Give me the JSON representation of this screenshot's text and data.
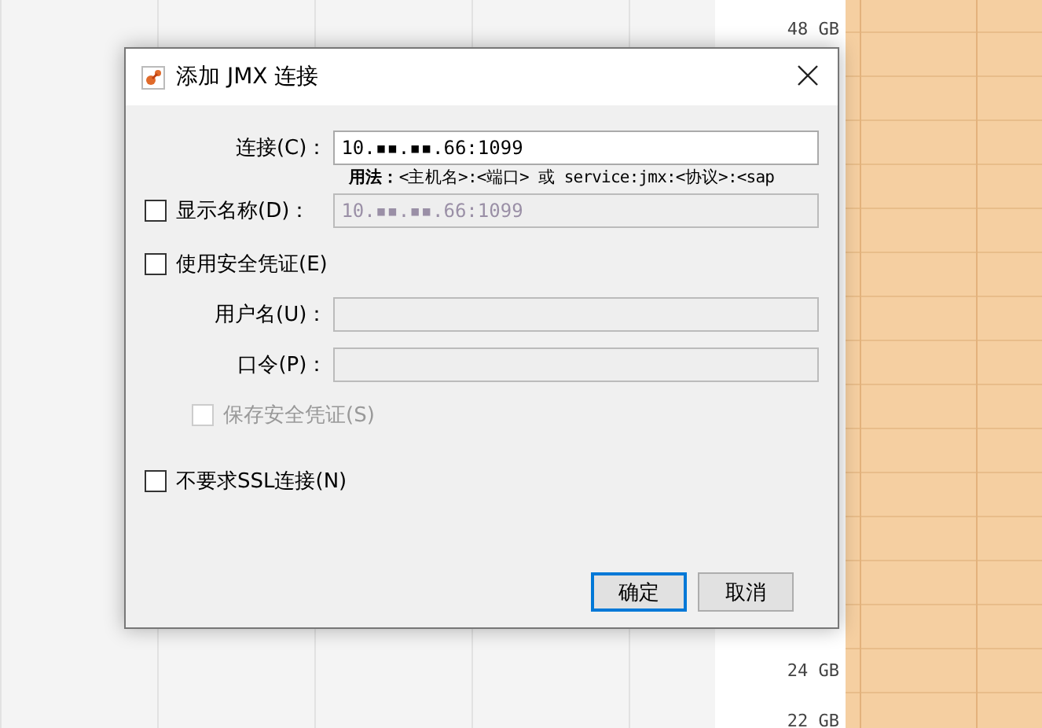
{
  "background_chart": {
    "axis_labels": [
      "48 GB",
      "24 GB",
      "22 GB"
    ]
  },
  "dialog": {
    "title": "添加 JMX 连接",
    "connection": {
      "label": "连接(C)：",
      "value": "10.▪▪.▪▪.66:1099",
      "hint": "**用法：**<主机名>:<端口> 或 service:jmx:<协议>:<sap"
    },
    "display_name": {
      "label": "显示名称(D)：",
      "checked": false,
      "value": "10.▪▪.▪▪.66:1099",
      "disabled": true
    },
    "use_credentials": {
      "label": "使用安全凭证(E)",
      "checked": false
    },
    "username": {
      "label": "用户名(U)：",
      "disabled": true
    },
    "password": {
      "label": "口令(P)：",
      "disabled": true
    },
    "save_credentials": {
      "label": "保存安全凭证(S)",
      "checked": false,
      "disabled": true
    },
    "no_ssl": {
      "label": "不要求SSL连接(N)",
      "checked": false
    },
    "buttons": [
      {
        "label": "确定",
        "focused": true
      },
      {
        "label": "取消",
        "focused": false
      }
    ]
  }
}
